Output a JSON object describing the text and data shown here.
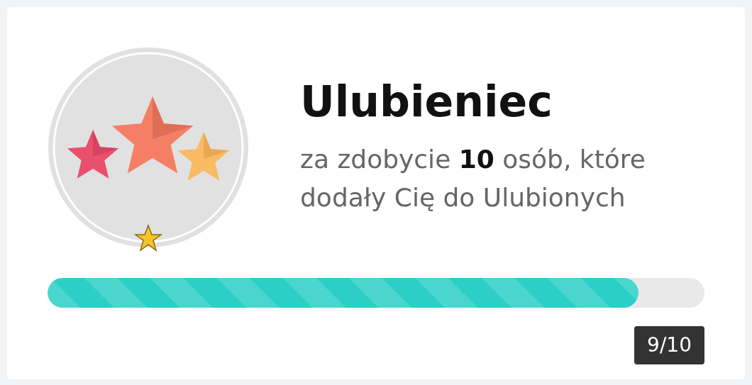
{
  "badge": {
    "title": "Ulubieniec",
    "description": "za zdobycie **10** osób, które dodały Cię do Ulubionych"
  },
  "progress": {
    "level": 0.9,
    "label": "9/10"
  }
}
